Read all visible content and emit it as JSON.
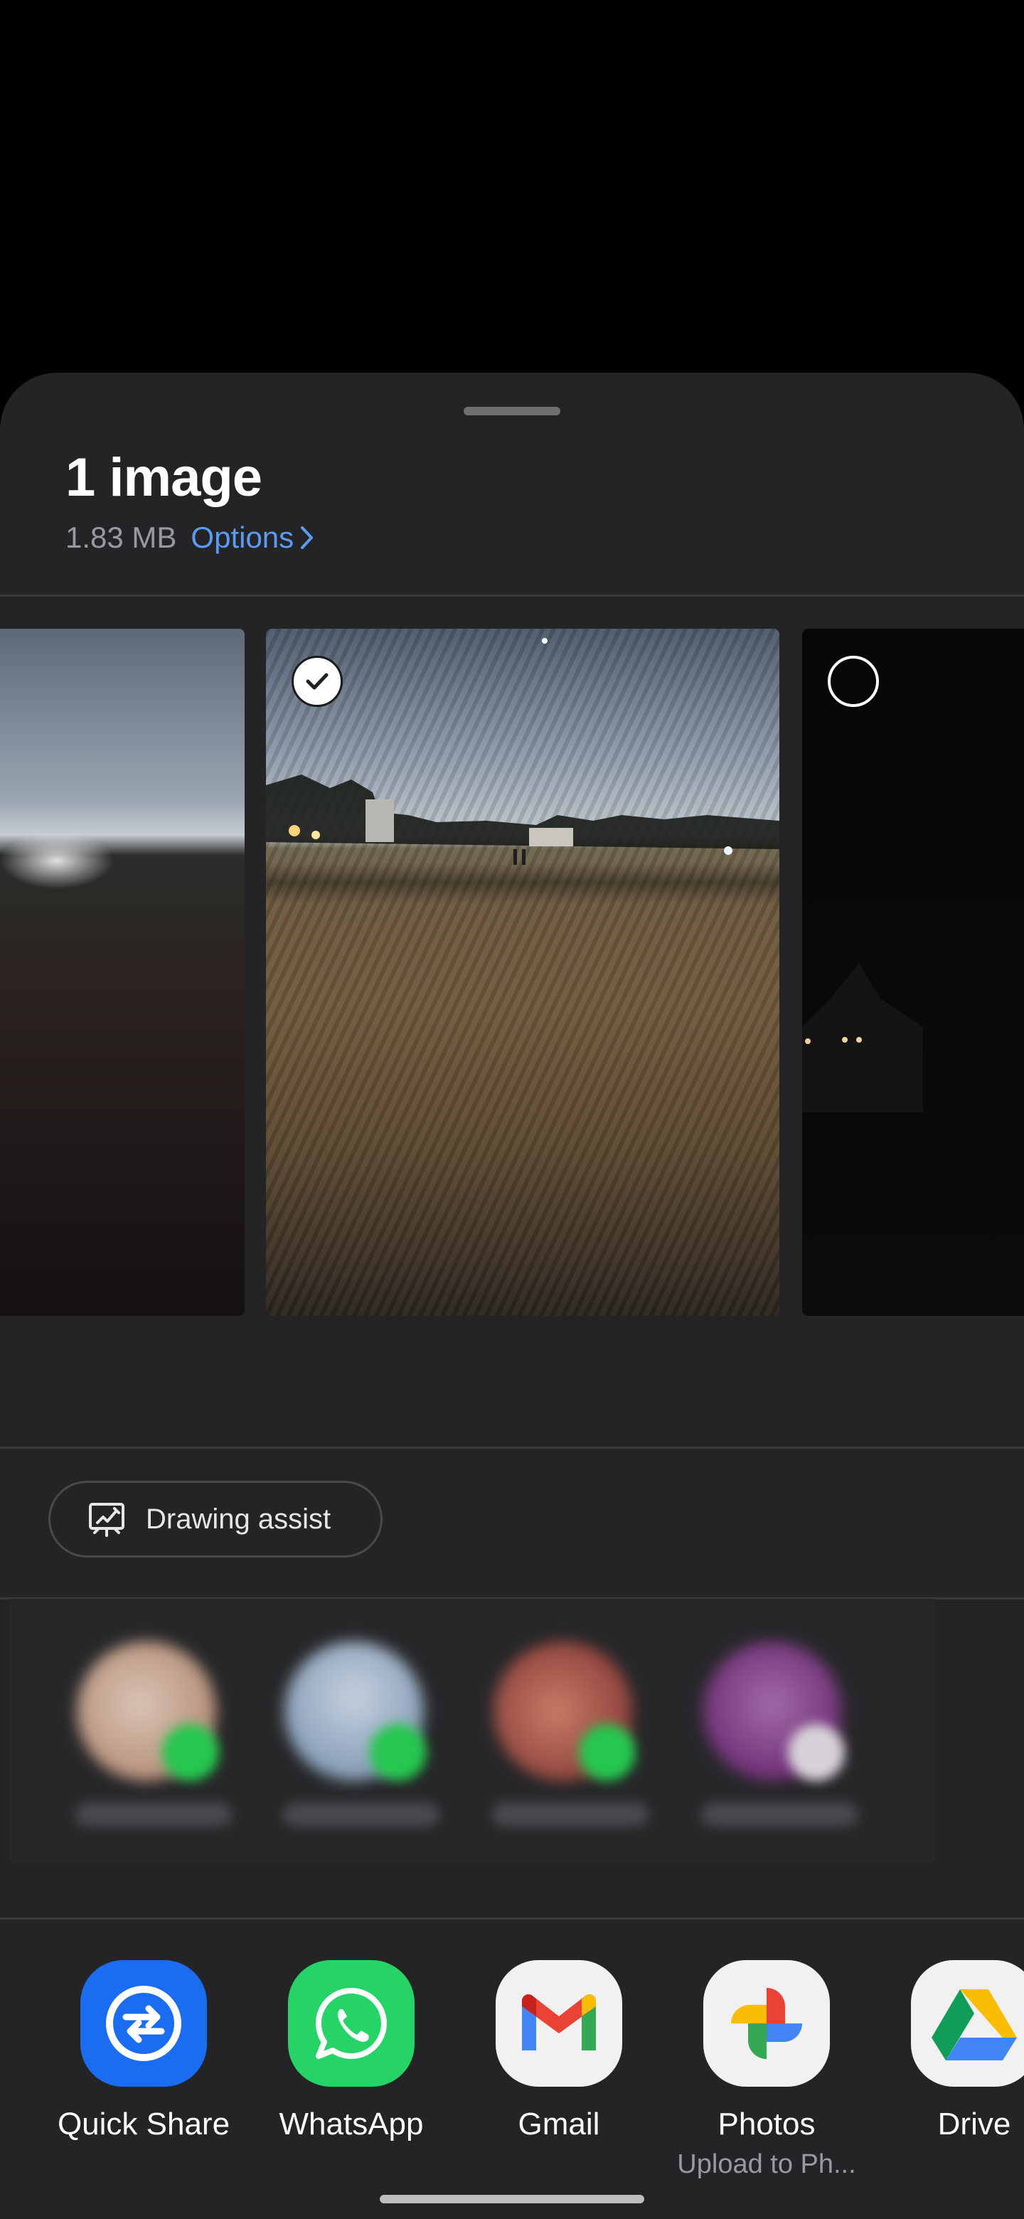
{
  "header": {
    "title": "1 image",
    "size": "1.83 MB",
    "options_label": "Options"
  },
  "thumbnails": [
    {
      "selected": null
    },
    {
      "selected": true
    },
    {
      "selected": false
    }
  ],
  "drawing_assist": {
    "label": "Drawing assist"
  },
  "contacts": [
    {
      "avatar_color": "#b89a86",
      "badge_color": "#25c74f"
    },
    {
      "avatar_color": "#8fa5bf",
      "badge_color": "#25c74f"
    },
    {
      "avatar_color": "#a4514a",
      "badge_color": "#25c74f"
    },
    {
      "avatar_color": "#7b2a87",
      "badge_color": "#d8d2d8"
    }
  ],
  "apps": [
    {
      "name": "Quick Share",
      "sub": "",
      "icon": "quick-share-icon",
      "bg": "#1a6cf0"
    },
    {
      "name": "WhatsApp",
      "sub": "",
      "icon": "whatsapp-icon",
      "bg": "#25d366"
    },
    {
      "name": "Gmail",
      "sub": "",
      "icon": "gmail-icon",
      "bg": "#f1f1f1"
    },
    {
      "name": "Photos",
      "sub": "Upload to Ph...",
      "icon": "google-photos-icon",
      "bg": "#f1f1f1"
    },
    {
      "name": "Drive",
      "sub": "",
      "icon": "google-drive-icon",
      "bg": "#f1f1f1"
    }
  ]
}
